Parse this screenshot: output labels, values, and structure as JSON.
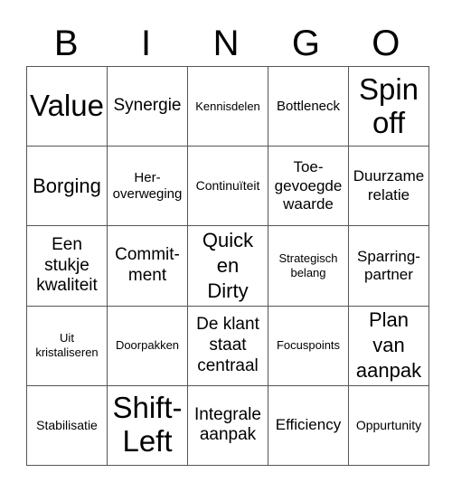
{
  "header": {
    "letters": [
      "B",
      "I",
      "N",
      "G",
      "O"
    ]
  },
  "grid": {
    "rows": [
      [
        "Value",
        "Synergie",
        "Kennisdelen",
        "Bottleneck",
        "Spin\noff"
      ],
      [
        "Borging",
        "Her-\noverweging",
        "Continuïteit",
        "Toe-\ngevoegde\nwaarde",
        "Duurzame\nrelatie"
      ],
      [
        "Een\nstukje\nkwaliteit",
        "Commit-\nment",
        "Quick\nen\nDirty",
        "Strategisch\nbelang",
        "Sparring-\npartner"
      ],
      [
        "Uit\nkristaliseren",
        "Doorpakken",
        "De klant\nstaat\ncentraal",
        "Focuspoints",
        "Plan\nvan\naanpak"
      ],
      [
        "Stabilisatie",
        "Shift-\nLeft",
        "Integrale\naanpak",
        "Efficiency",
        "Oppurtunity"
      ]
    ]
  }
}
